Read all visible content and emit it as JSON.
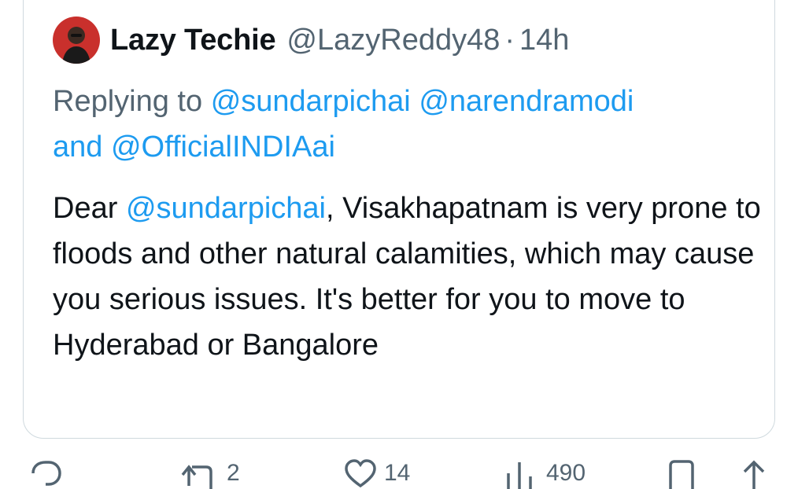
{
  "tweet": {
    "author_name": "Lazy Techie",
    "handle": "@LazyReddy48",
    "separator": "·",
    "time": "14h",
    "replying_prefix": "Replying to",
    "reply_mention_1": "@sundarpichai",
    "reply_mention_2": "@narendramodi",
    "reply_and": "and",
    "reply_mention_3": "@OfficialINDIAai",
    "body_greeting": "Dear",
    "body_mention": "@sundarpichai",
    "body_text": ", Visakhapatnam is very prone to floods and other natural calamities, which may cause you serious issues. It's better for you to move to Hyderabad or Bangalore"
  },
  "actions": {
    "reply_icon": "reply-icon",
    "retweet_icon": "retweet-icon",
    "retweet_count": "2",
    "like_icon": "heart-icon",
    "like_count": "14",
    "views_icon": "views-icon",
    "views_count": "490",
    "bookmark_icon": "bookmark-icon",
    "share_icon": "share-icon"
  },
  "colors": {
    "link": "#1d9bf0",
    "secondary_text": "#536471",
    "border": "#cfd9de"
  }
}
